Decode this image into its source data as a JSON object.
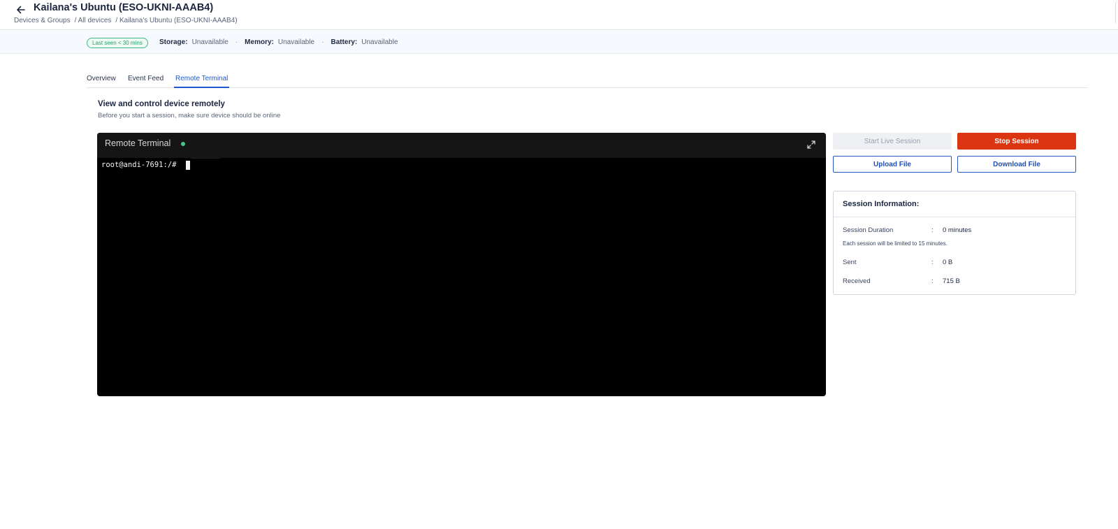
{
  "header": {
    "title": "Kailana's Ubuntu (ESO-UKNI-AAAB4)",
    "breadcrumb": [
      "Devices & Groups",
      "/ All devices",
      "/ Kailana's Ubuntu (ESO-UKNI-AAAB4)"
    ]
  },
  "status": {
    "badge": "Last seen < 30 mins",
    "storage_label": "Storage:",
    "storage_value": "Unavailable",
    "memory_label": "Memory:",
    "memory_value": "Unavailable",
    "battery_label": "Battery:",
    "battery_value": "Unavailable"
  },
  "tabs": [
    {
      "label": "Overview",
      "active": false
    },
    {
      "label": "Event Feed",
      "active": false
    },
    {
      "label": "Remote Terminal",
      "active": true
    }
  ],
  "section": {
    "title": "View and control device remotely",
    "subtitle": "Before you start a session, make sure device should be online"
  },
  "terminal": {
    "title": "Remote Terminal",
    "prompt": "root@andi-7691:/# "
  },
  "actions": {
    "start_label": "Start Live Session",
    "stop_label": "Stop Session",
    "upload_label": "Upload File",
    "download_label": "Download File"
  },
  "session_info": {
    "title": "Session Information:",
    "duration_label": "Session Duration",
    "duration_value": "0 minutes",
    "note": "Each session will be limited to 15 minutes.",
    "sent_label": "Sent",
    "sent_value": "0 B",
    "received_label": "Received",
    "received_value": "715 B",
    "colon": ":"
  },
  "colors": {
    "accent": "#1e57c9",
    "danger": "#dc3512",
    "online": "#48c58e"
  }
}
